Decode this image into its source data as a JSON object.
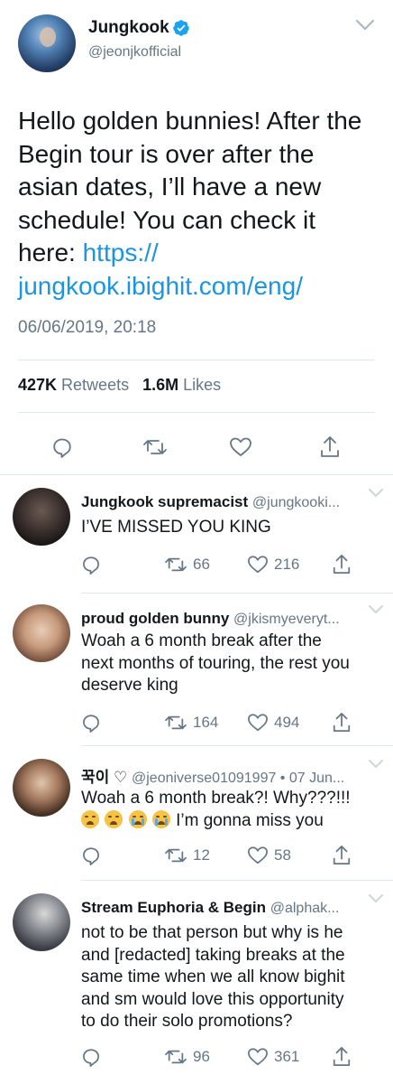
{
  "main_tweet": {
    "author_name": "Jungkook",
    "author_handle": "@jeonjkofficial",
    "text_lines": [
      "Hello golden bunnies! After the",
      "Begin tour is over after the",
      "asian dates, I’ll have a new",
      "schedule! You can check it",
      "here: "
    ],
    "link_part1": "https://",
    "link_part2": "jungkook.ibighit.com/eng/",
    "timestamp": "06/06/2019, 20:18",
    "retweets_count": "427K",
    "retweets_label": "Retweets",
    "likes_count": "1.6M",
    "likes_label": "Likes"
  },
  "replies": [
    {
      "name": "Jungkook supremacist",
      "handle": "@jungkooki...",
      "text": "I’VE MISSED YOU KING",
      "retweets": "66",
      "likes": "216"
    },
    {
      "name": "proud golden bunny",
      "handle": "@jkismyeveryt...",
      "text_lines": [
        "Woah a 6 month break after the",
        "next months of touring, the rest you",
        "deserve king"
      ],
      "retweets": "164",
      "likes": "494"
    },
    {
      "name": "꾹이",
      "name_suffix": "♡",
      "handle": "@jeoniverse01091997 • 07 Jun...",
      "text_line1": "Woah a 6 month break?! Why???!!!",
      "text_line2": "I’m gonna miss you",
      "emojis": [
        "tired-face",
        "tired-face",
        "crying-face",
        "crying-face"
      ],
      "retweets": "12",
      "likes": "58"
    },
    {
      "name": "Stream Euphoria & Begin",
      "handle": "@alphak...",
      "text_lines": [
        "not to be that person but why is he",
        "and [redacted] taking breaks at the",
        "same time when we all know bighit",
        "and sm would love this opportunity",
        "to do their solo promotions?"
      ],
      "retweets": "96",
      "likes": "361"
    }
  ],
  "colors": {
    "text": "#14171a",
    "secondary": "#657786",
    "link": "#1b95e0",
    "divider": "#e1e8ed",
    "verified": "#1da1f2"
  }
}
